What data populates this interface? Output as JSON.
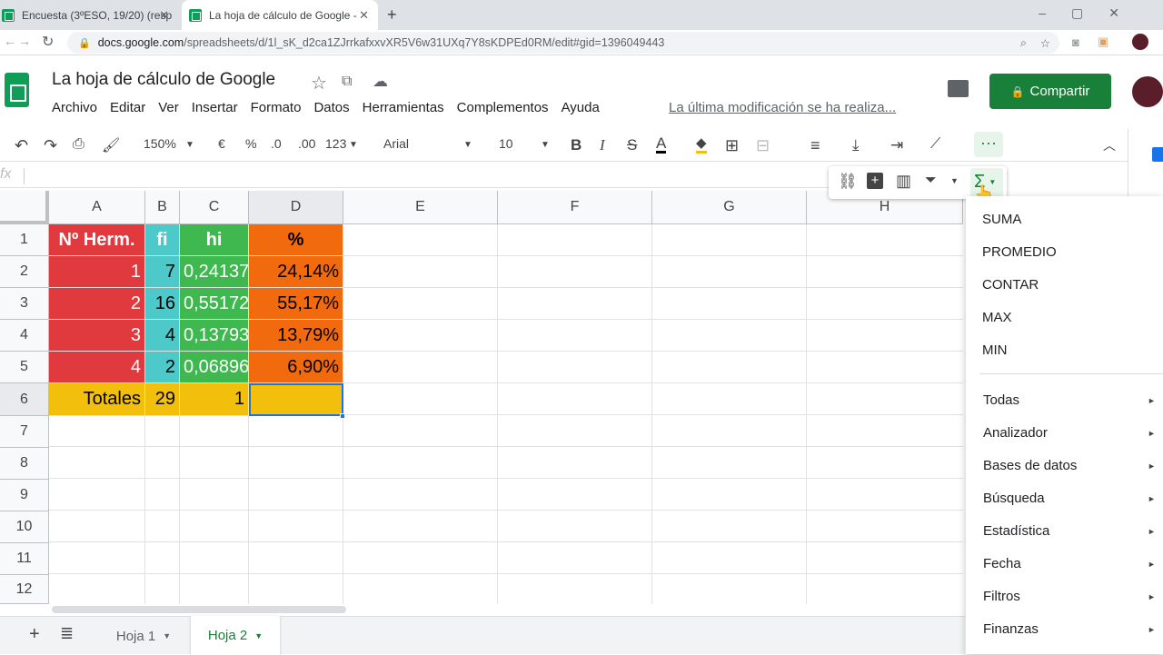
{
  "browser": {
    "tabs": [
      {
        "title": "Encuesta (3ºESO, 19/20) (resp"
      },
      {
        "title": "La hoja de cálculo de Google -"
      }
    ],
    "url_host": "docs.google.com",
    "url_path": "/spreadsheets/d/1l_sK_d2ca1ZJrrkafxxvXR5V6w31UXq7Y8sKDPEd0RM/edit#gid=1396049443"
  },
  "doc": {
    "title": "La hoja de cálculo de Google",
    "menus": [
      "Archivo",
      "Editar",
      "Ver",
      "Insertar",
      "Formato",
      "Datos",
      "Herramientas",
      "Complementos",
      "Ayuda"
    ],
    "last_modified": "La última modificación se ha realiza...",
    "share_label": "Compartir"
  },
  "toolbar": {
    "zoom": "150%",
    "currency": "€",
    "percent": "%",
    "dec_less": ".0",
    "dec_more": ".00",
    "more_formats": "123",
    "font": "Arial",
    "font_size": "10"
  },
  "formula_bar": {
    "fx": "fx"
  },
  "grid": {
    "columns": [
      "A",
      "B",
      "C",
      "D",
      "E",
      "F",
      "G",
      "H"
    ],
    "rows": [
      "1",
      "2",
      "3",
      "4",
      "5",
      "6",
      "7",
      "8",
      "9",
      "10",
      "11",
      "12"
    ],
    "header": [
      "Nº Herm.",
      "fi",
      "hi",
      "%"
    ],
    "data": [
      [
        "1",
        "7",
        "0,24137",
        "24,14%"
      ],
      [
        "2",
        "16",
        "0,55172",
        "55,17%"
      ],
      [
        "3",
        "4",
        "0,13793",
        "13,79%"
      ],
      [
        "4",
        "2",
        "0,06896",
        "6,90%"
      ]
    ],
    "totals": [
      "Totales",
      "29",
      "1",
      ""
    ]
  },
  "colors": {
    "colA": "#e0393e",
    "colB": "#4dc9c9",
    "colC": "#3fb94f",
    "colD": "#f26a0e",
    "totals": "#f2bf0c",
    "share": "#188038"
  },
  "functions_menu": {
    "quick": [
      "SUMA",
      "PROMEDIO",
      "CONTAR",
      "MAX",
      "MIN"
    ],
    "categories": [
      "Todas",
      "Analizador",
      "Bases de datos",
      "Búsqueda",
      "Estadística",
      "Fecha",
      "Filtros",
      "Finanzas"
    ]
  },
  "sheets": {
    "tabs": [
      "Hoja 1",
      "Hoja 2"
    ],
    "active": "Hoja 2"
  }
}
